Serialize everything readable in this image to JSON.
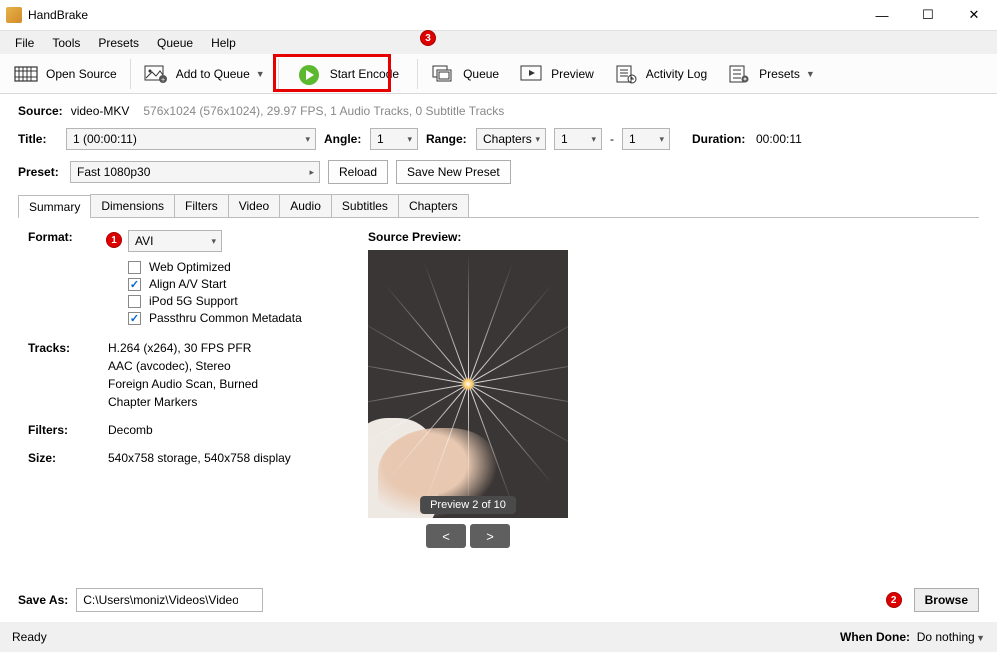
{
  "app": {
    "title": "HandBrake"
  },
  "menu": {
    "file": "File",
    "tools": "Tools",
    "presets": "Presets",
    "queue": "Queue",
    "help": "Help"
  },
  "toolbar": {
    "open": "Open Source",
    "add_queue": "Add to Queue",
    "start": "Start Encode",
    "queue": "Queue",
    "preview": "Preview",
    "activity": "Activity Log",
    "presets": "Presets"
  },
  "badges": {
    "b1": "1",
    "b2": "2",
    "b3": "3"
  },
  "source": {
    "label": "Source:",
    "name": "video-MKV",
    "meta": "576x1024 (576x1024), 29.97 FPS, 1 Audio Tracks, 0 Subtitle Tracks"
  },
  "title_row": {
    "title_lbl": "Title:",
    "title_val": "1  (00:00:11)",
    "angle_lbl": "Angle:",
    "angle_val": "1",
    "range_lbl": "Range:",
    "range_val": "Chapters",
    "range_from": "1",
    "range_dash": "-",
    "range_to": "1",
    "dur_lbl": "Duration:",
    "dur_val": "00:00:11"
  },
  "preset_row": {
    "preset_lbl": "Preset:",
    "preset_val": "Fast 1080p30",
    "reload": "Reload",
    "savenew": "Save New Preset"
  },
  "tabs": {
    "summary": "Summary",
    "dimensions": "Dimensions",
    "filters": "Filters",
    "video": "Video",
    "audio": "Audio",
    "subtitles": "Subtitles",
    "chapters": "Chapters"
  },
  "summary": {
    "format_lbl": "Format:",
    "format_val": "AVI",
    "chk_web": "Web Optimized",
    "chk_av": "Align A/V Start",
    "chk_ipod": "iPod 5G Support",
    "chk_meta": "Passthru Common Metadata",
    "tracks_lbl": "Tracks:",
    "tracks": [
      "H.264 (x264), 30 FPS PFR",
      "AAC (avcodec), Stereo",
      "Foreign Audio Scan, Burned",
      "Chapter Markers"
    ],
    "filters_lbl": "Filters:",
    "filters_val": "Decomb",
    "size_lbl": "Size:",
    "size_val": "540x758 storage, 540x758 display",
    "preview_lbl": "Source Preview:",
    "preview_caption": "Preview 2 of 10",
    "prev": "<",
    "next": ">"
  },
  "saveas": {
    "label": "Save As:",
    "path": "C:\\Users\\moniz\\Videos\\Video-Mkv.avi",
    "browse": "Browse"
  },
  "status": {
    "ready": "Ready",
    "whendone_lbl": "When Done:",
    "whendone_val": "Do nothing"
  }
}
